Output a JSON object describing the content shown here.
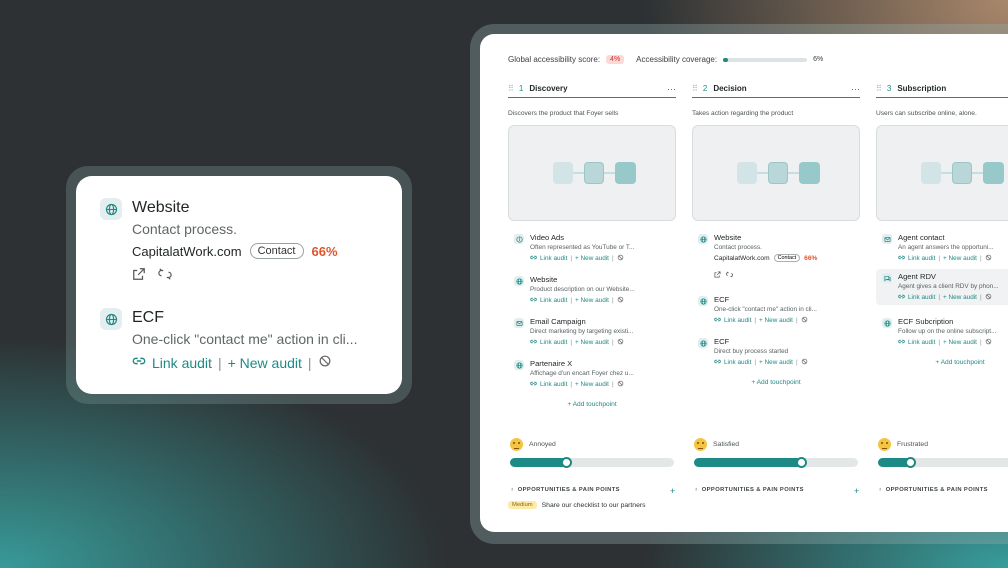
{
  "zoom": {
    "items": [
      {
        "icon": "globe-icon",
        "title": "Website",
        "desc": "Contact process.",
        "site": "CapitalatWork.com",
        "pill": "Contact",
        "pct": "66%"
      },
      {
        "icon": "globe-icon",
        "title": "ECF",
        "desc": "One-click \"contact me\" action in cli...",
        "link_audit": "Link audit",
        "sep": "|",
        "new_audit": "+ New audit"
      }
    ]
  },
  "header": {
    "score_label": "Global accessibility score:",
    "score_value": "4%",
    "coverage_label": "Accessibility coverage:",
    "coverage_value": "6%",
    "coverage_fraction": 0.06
  },
  "colors": {
    "accent": "#1d8a86",
    "danger": "#e2542d"
  },
  "stages": [
    {
      "num": "1",
      "title": "Discovery",
      "desc": "Discovers the product that Foyer sells",
      "touchpoints": [
        {
          "icon": "info-icon",
          "title": "Video Ads",
          "desc": "Often represented as YouTube or T...",
          "link_audit": "Link audit",
          "new_audit": "+ New audit"
        },
        {
          "icon": "globe-icon",
          "title": "Website",
          "desc": "Product description on our Website...",
          "link_audit": "Link audit",
          "new_audit": "+ New audit"
        },
        {
          "icon": "mail-icon",
          "title": "Email Campaign",
          "desc": "Direct marketing by targeting existi...",
          "link_audit": "Link audit",
          "new_audit": "+ New audit"
        },
        {
          "icon": "globe-icon",
          "title": "Partenaire X",
          "desc": "Affichage d'un encart Foyer chez u...",
          "link_audit": "Link audit",
          "new_audit": "+ New audit"
        }
      ],
      "add_label": "+ Add touchpoint",
      "mood": "Annoyed",
      "mood_level": 0.35
    },
    {
      "num": "2",
      "title": "Decision",
      "desc": "Takes action regarding the product",
      "touchpoints": [
        {
          "icon": "globe-icon",
          "title": "Website",
          "desc": "Contact process.",
          "site": "CapitalatWork.com",
          "pill": "Contact",
          "pct": "66%"
        },
        {
          "icon": "globe-icon",
          "title": "ECF",
          "desc": "One-click \"contact me\" action in cli...",
          "link_audit": "Link audit",
          "new_audit": "+ New audit"
        },
        {
          "icon": "globe-icon",
          "title": "ECF",
          "desc": "Direct buy process started",
          "link_audit": "Link audit",
          "new_audit": "+ New audit"
        }
      ],
      "add_label": "+ Add touchpoint",
      "mood": "Satisfied",
      "mood_level": 0.66
    },
    {
      "num": "3",
      "title": "Subscription",
      "desc": "Users can subscribe online, alone.",
      "touchpoints": [
        {
          "icon": "mail-icon",
          "title": "Agent contact",
          "desc": "An agent answers the opportuni...",
          "link_audit": "Link audit",
          "new_audit": "+ New audit"
        },
        {
          "icon": "chat-icon",
          "title": "Agent RDV",
          "desc": "Agent gives a client RDV by phon...",
          "link_audit": "Link audit",
          "new_audit": "+ New audit",
          "highlight": true
        },
        {
          "icon": "globe-icon",
          "title": "ECF Subcription",
          "desc": "Follow up on the online subscript...",
          "link_audit": "Link audit",
          "new_audit": "+ New audit"
        }
      ],
      "add_label": "+ Add touchpoint",
      "mood": "Frustrated",
      "mood_level": 0.2
    }
  ],
  "opportunities": {
    "label": "OPPORTUNITIES & PAIN POINTS",
    "badge": "Medium",
    "item": "Share our checklist to our partners"
  },
  "ui": {
    "sep": "|",
    "dots": "···",
    "drag": "⠿",
    "plus": "+",
    "bulb": "♁"
  }
}
